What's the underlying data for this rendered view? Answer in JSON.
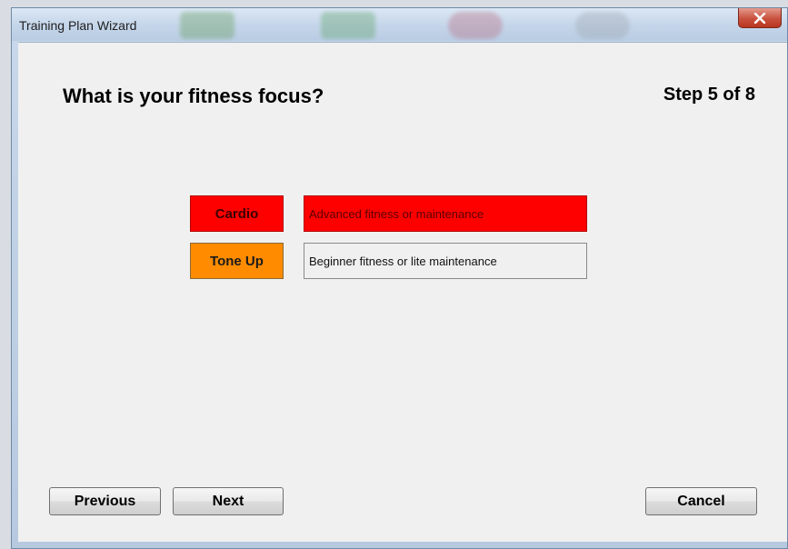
{
  "window": {
    "title": "Training Plan Wizard",
    "close_label": "x"
  },
  "wizard": {
    "heading": "What is your fitness focus?",
    "step": "Step 5 of 8",
    "options": [
      {
        "label": "Cardio",
        "description": "Advanced fitness or maintenance",
        "color": "#ff0000",
        "selected": true
      },
      {
        "label": "Tone Up",
        "description": "Beginner fitness or lite maintenance",
        "color": "#ff8c00",
        "selected": false
      }
    ]
  },
  "buttons": {
    "previous": "Previous",
    "next": "Next",
    "cancel": "Cancel"
  },
  "colors": {
    "client_bg": "#f0f0f0",
    "close_button": "#c9513e"
  }
}
